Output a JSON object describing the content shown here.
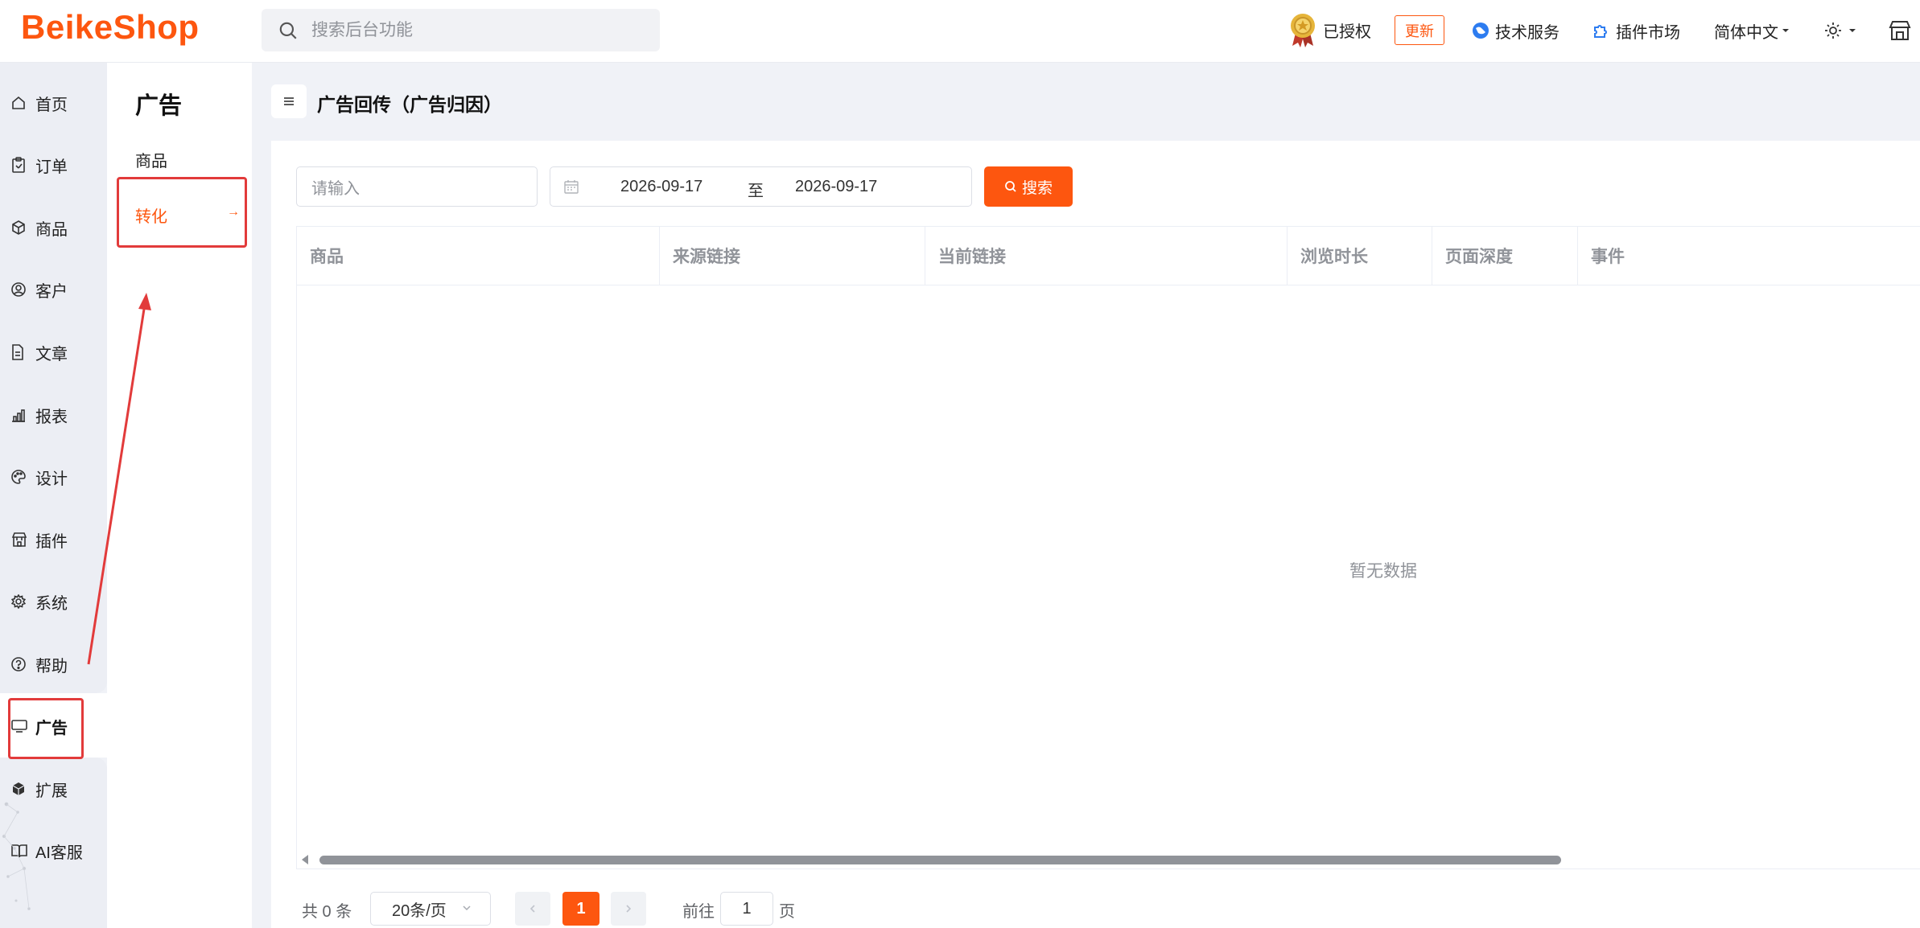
{
  "header": {
    "logo": "BeikeShop",
    "search_placeholder": "搜索后台功能",
    "licensed": "已授权",
    "update": "更新",
    "tech_service": "技术服务",
    "plugin_market": "插件市场",
    "language": "简体中文"
  },
  "sidebar": {
    "items": [
      {
        "label": "首页",
        "icon": "home-icon"
      },
      {
        "label": "订单",
        "icon": "clipboard-icon"
      },
      {
        "label": "商品",
        "icon": "box-icon"
      },
      {
        "label": "客户",
        "icon": "user-icon"
      },
      {
        "label": "文章",
        "icon": "document-icon"
      },
      {
        "label": "报表",
        "icon": "bar-chart-icon"
      },
      {
        "label": "设计",
        "icon": "palette-icon"
      },
      {
        "label": "插件",
        "icon": "shop-icon"
      },
      {
        "label": "系统",
        "icon": "gear-icon"
      },
      {
        "label": "帮助",
        "icon": "help-icon"
      },
      {
        "label": "广告",
        "icon": "monitor-icon",
        "active": true
      },
      {
        "label": "扩展",
        "icon": "cube-icon"
      },
      {
        "label": "AI客服",
        "icon": "book-icon"
      }
    ]
  },
  "subnav": {
    "title": "广告",
    "items": [
      {
        "label": "商品"
      },
      {
        "label": "转化",
        "active": true
      }
    ]
  },
  "page": {
    "title": "广告回传（广告归因）"
  },
  "filters": {
    "input_placeholder": "请输入",
    "date_start": "2026-09-17",
    "date_separator": "至",
    "date_end": "2026-09-17",
    "search_button": "搜索"
  },
  "table": {
    "columns": [
      "商品",
      "来源链接",
      "当前链接",
      "浏览时长",
      "页面深度",
      "事件"
    ],
    "empty_text": "暂无数据"
  },
  "pagination": {
    "total": "共 0 条",
    "page_size": "20条/页",
    "current_page": "1",
    "goto_label": "前往",
    "goto_value": "1",
    "page_suffix": "页"
  },
  "colors": {
    "brand": "#fd560f",
    "highlight": "#e23b3b"
  }
}
